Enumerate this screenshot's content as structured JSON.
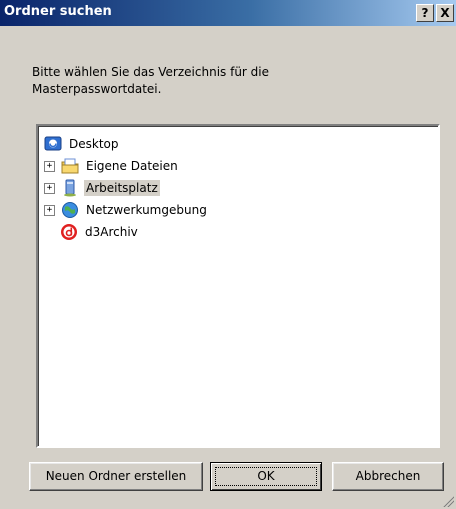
{
  "window": {
    "title": "Ordner suchen",
    "help_label": "?",
    "close_label": "X"
  },
  "prompt": "Bitte wählen Sie das Verzeichnis für die\nMasterpasswortdatei.",
  "tree": {
    "items": [
      {
        "label": "Desktop",
        "icon": "desktop-icon",
        "expander": ""
      },
      {
        "label": "Eigene Dateien",
        "icon": "my-documents-icon",
        "expander": "+"
      },
      {
        "label": "Arbeitsplatz",
        "icon": "my-computer-icon",
        "expander": "+",
        "selected": true
      },
      {
        "label": "Netzwerkumgebung",
        "icon": "network-places-icon",
        "expander": "+"
      },
      {
        "label": "d3Archiv",
        "icon": "d3archiv-icon",
        "expander": ""
      }
    ]
  },
  "buttons": {
    "new_folder": "Neuen Ordner erstellen",
    "ok": "OK",
    "cancel": "Abbrechen"
  }
}
